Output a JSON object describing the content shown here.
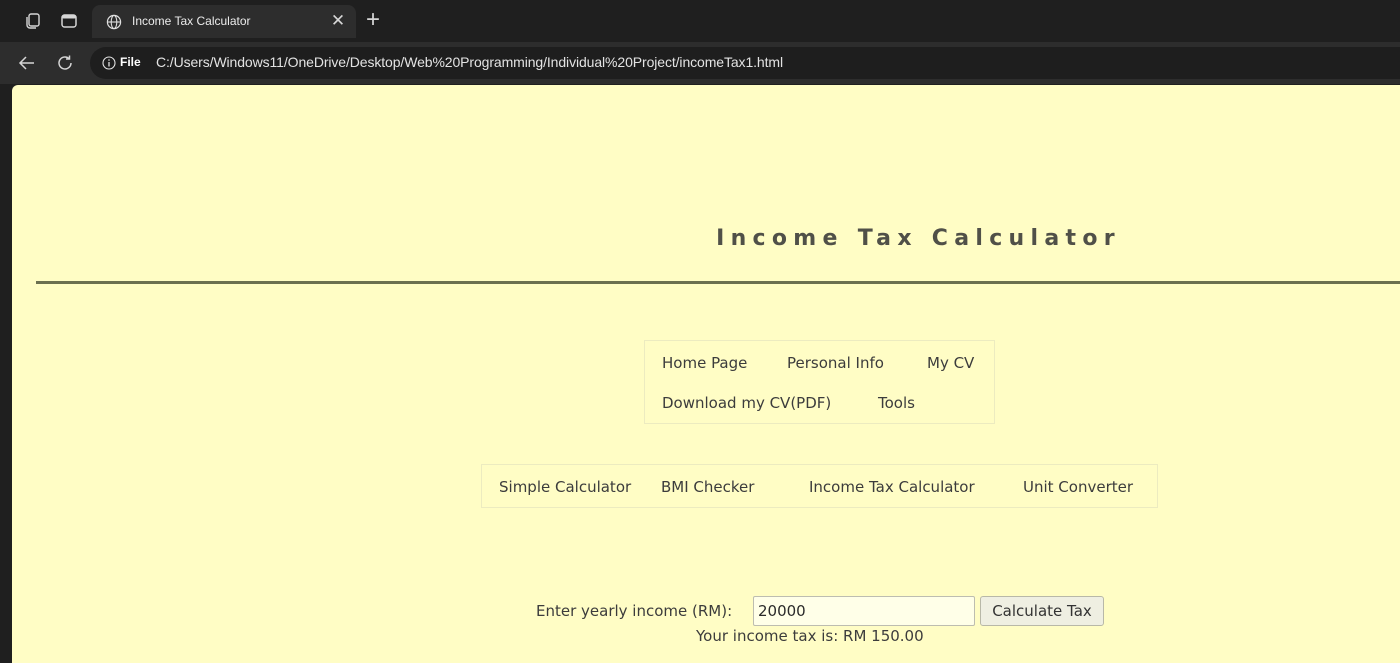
{
  "browser": {
    "tab": {
      "title": "Income Tax Calculator"
    },
    "address_bar": {
      "scheme_badge": "File",
      "url": "C:/Users/Windows11/OneDrive/Desktop/Web%20Programming/Individual%20Project/incomeTax1.html"
    }
  },
  "page": {
    "title": "Income Tax Calculator",
    "main_menu": [
      "Home Page",
      "Personal Info",
      "My CV",
      "Download my CV(PDF)",
      "Tools"
    ],
    "tools_menu": [
      "Simple Calculator",
      "BMI Checker",
      "Income Tax Calculator",
      "Unit Converter"
    ],
    "form": {
      "label": "Enter yearly income (RM):",
      "input_value": "20000",
      "button_label": "Calculate Tax"
    },
    "result": "Your income tax is: RM 150.00",
    "colors": {
      "page_background": "#fffdc5",
      "title_rule": "#6b7050",
      "browser_chrome": "#1f1f1f"
    }
  }
}
